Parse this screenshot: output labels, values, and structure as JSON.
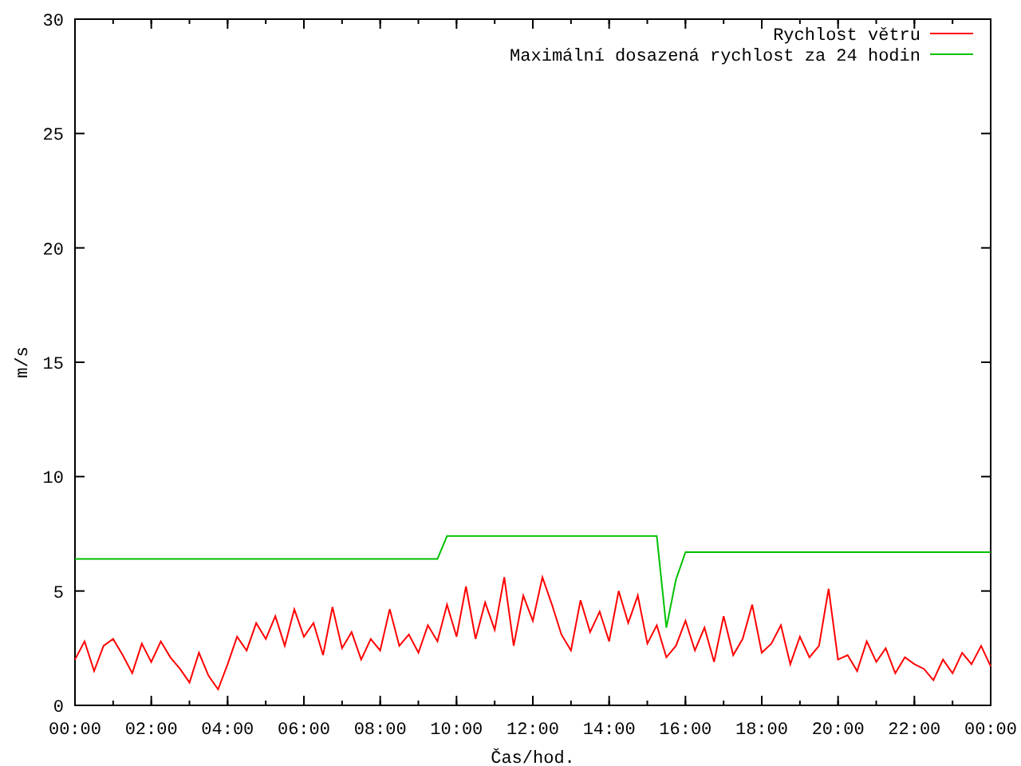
{
  "chart_data": {
    "type": "line",
    "xlabel": "Čas/hod.",
    "ylabel": "m/s",
    "x": [
      0,
      0.25,
      0.5,
      0.75,
      1,
      1.25,
      1.5,
      1.75,
      2,
      2.25,
      2.5,
      2.75,
      3,
      3.25,
      3.5,
      3.75,
      4,
      4.25,
      4.5,
      4.75,
      5,
      5.25,
      5.5,
      5.75,
      6,
      6.25,
      6.5,
      6.75,
      7,
      7.25,
      7.5,
      7.75,
      8,
      8.25,
      8.5,
      8.75,
      9,
      9.25,
      9.5,
      9.75,
      10,
      10.25,
      10.5,
      10.75,
      11,
      11.25,
      11.5,
      11.75,
      12,
      12.25,
      12.5,
      12.75,
      13,
      13.25,
      13.5,
      13.75,
      14,
      14.25,
      14.5,
      14.75,
      15,
      15.25,
      15.5,
      15.75,
      16,
      16.25,
      16.5,
      16.75,
      17,
      17.25,
      17.5,
      17.75,
      18,
      18.25,
      18.5,
      18.75,
      19,
      19.25,
      19.5,
      19.75,
      20,
      20.25,
      20.5,
      20.75,
      21,
      21.25,
      21.5,
      21.75,
      22,
      22.25,
      22.5,
      22.75,
      23,
      23.25,
      23.5,
      23.75,
      24
    ],
    "series": [
      {
        "name": "Rychlost větru",
        "color": "#ff0000",
        "values": [
          2.0,
          2.8,
          1.5,
          2.6,
          2.9,
          2.2,
          1.4,
          2.7,
          1.9,
          2.8,
          2.1,
          1.6,
          1.0,
          2.3,
          1.3,
          0.7,
          1.8,
          3.0,
          2.4,
          3.6,
          2.9,
          3.9,
          2.6,
          4.2,
          3.0,
          3.6,
          2.2,
          4.3,
          2.5,
          3.2,
          2.0,
          2.9,
          2.4,
          4.2,
          2.6,
          3.1,
          2.3,
          3.5,
          2.8,
          4.4,
          3.0,
          5.2,
          2.9,
          4.5,
          3.3,
          5.6,
          2.6,
          4.8,
          3.7,
          5.6,
          4.4,
          3.1,
          2.4,
          4.6,
          3.2,
          4.1,
          2.8,
          5.0,
          3.6,
          4.8,
          2.7,
          3.5,
          2.1,
          2.6,
          3.7,
          2.4,
          3.4,
          1.9,
          3.9,
          2.2,
          2.9,
          4.4,
          2.3,
          2.7,
          3.5,
          1.8,
          3.0,
          2.1,
          2.6,
          5.1,
          2.0,
          2.2,
          1.5,
          2.8,
          1.9,
          2.5,
          1.4,
          2.1,
          1.8,
          1.6,
          1.1,
          2.0,
          1.4,
          2.3,
          1.8,
          2.6,
          1.7
        ]
      },
      {
        "name": "Maximální dosazená rychlost za 24 hodin",
        "color": "#00c000",
        "values": [
          6.4,
          6.4,
          6.4,
          6.4,
          6.4,
          6.4,
          6.4,
          6.4,
          6.4,
          6.4,
          6.4,
          6.4,
          6.4,
          6.4,
          6.4,
          6.4,
          6.4,
          6.4,
          6.4,
          6.4,
          6.4,
          6.4,
          6.4,
          6.4,
          6.4,
          6.4,
          6.4,
          6.4,
          6.4,
          6.4,
          6.4,
          6.4,
          6.4,
          6.4,
          6.4,
          6.4,
          6.4,
          6.4,
          6.4,
          7.4,
          7.4,
          7.4,
          7.4,
          7.4,
          7.4,
          7.4,
          7.4,
          7.4,
          7.4,
          7.4,
          7.4,
          7.4,
          7.4,
          7.4,
          7.4,
          7.4,
          7.4,
          7.4,
          7.4,
          7.4,
          7.4,
          7.4,
          3.4,
          5.5,
          6.7,
          6.7,
          6.7,
          6.7,
          6.7,
          6.7,
          6.7,
          6.7,
          6.7,
          6.7,
          6.7,
          6.7,
          6.7,
          6.7,
          6.7,
          6.7,
          6.7,
          6.7,
          6.7,
          6.7,
          6.7,
          6.7,
          6.7,
          6.7,
          6.7,
          6.7,
          6.7,
          6.7,
          6.7,
          6.7,
          6.7,
          6.7,
          6.7
        ]
      }
    ],
    "xlim": [
      0,
      24
    ],
    "ylim": [
      0,
      30
    ],
    "xticks": [
      {
        "value": 0,
        "label": "00:00"
      },
      {
        "value": 2,
        "label": "02:00"
      },
      {
        "value": 4,
        "label": "04:00"
      },
      {
        "value": 6,
        "label": "06:00"
      },
      {
        "value": 8,
        "label": "08:00"
      },
      {
        "value": 10,
        "label": "10:00"
      },
      {
        "value": 12,
        "label": "12:00"
      },
      {
        "value": 14,
        "label": "14:00"
      },
      {
        "value": 16,
        "label": "16:00"
      },
      {
        "value": 18,
        "label": "18:00"
      },
      {
        "value": 20,
        "label": "20:00"
      },
      {
        "value": 22,
        "label": "22:00"
      },
      {
        "value": 24,
        "label": "00:00"
      }
    ],
    "yticks": [
      0,
      5,
      10,
      15,
      20,
      25,
      30
    ],
    "legend": true
  }
}
